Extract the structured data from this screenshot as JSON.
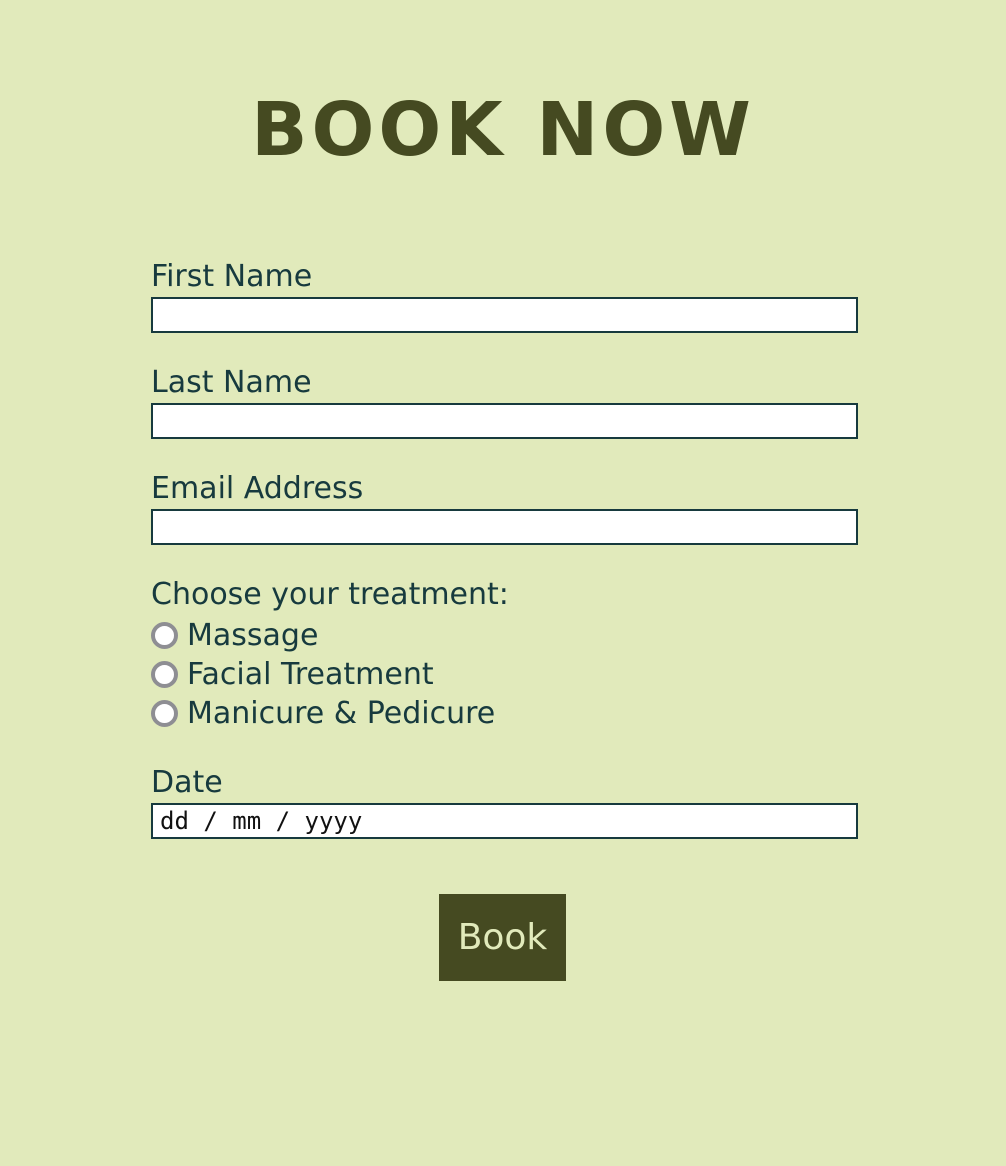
{
  "header": {
    "title": "BOOK NOW"
  },
  "form": {
    "first_name": {
      "label": "First Name",
      "value": ""
    },
    "last_name": {
      "label": "Last Name",
      "value": ""
    },
    "email": {
      "label": "Email Address",
      "value": ""
    },
    "treatment": {
      "legend": "Choose your treatment:",
      "options": [
        {
          "label": "Massage",
          "selected": false
        },
        {
          "label": "Facial Treatment",
          "selected": false
        },
        {
          "label": "Manicure & Pedicure",
          "selected": false
        }
      ]
    },
    "date": {
      "label": "Date",
      "placeholder": "dd / mm / yyyy"
    },
    "submit_label": "Book"
  },
  "colors": {
    "background": "#e1eabb",
    "title": "#454a21",
    "text": "#173a3e",
    "button_bg": "#454a21",
    "button_text": "#e1eabb",
    "radio_border": "#8e8e93"
  }
}
